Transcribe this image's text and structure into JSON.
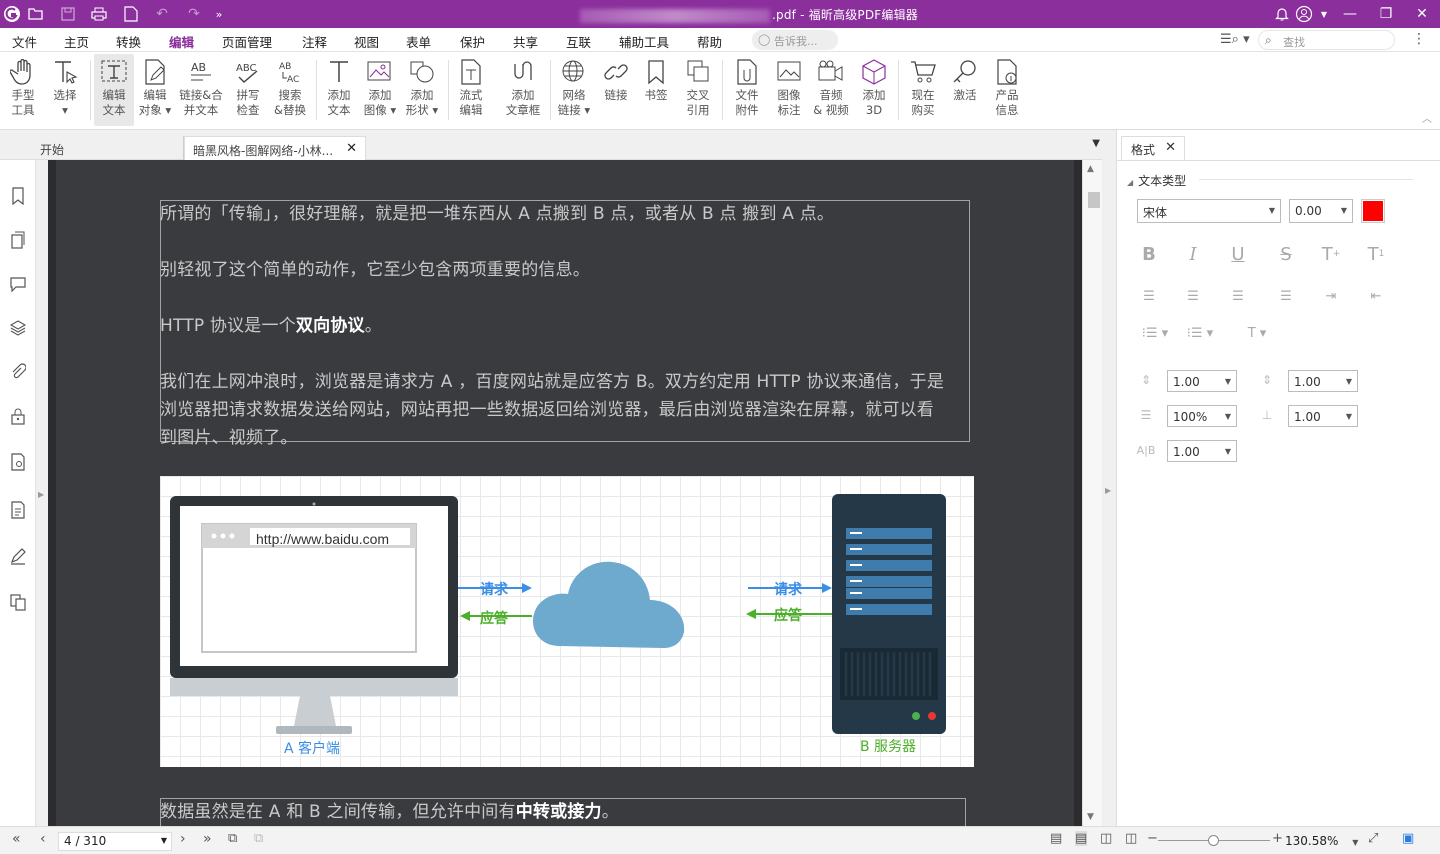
{
  "titlebar": {
    "title": ".pdf - 福昕高级PDF编辑器",
    "bg_color": "#8b2f9c"
  },
  "menu": {
    "items": [
      "文件",
      "主页",
      "转换",
      "编辑",
      "页面管理",
      "注释",
      "视图",
      "表单",
      "保护",
      "共享",
      "互联",
      "辅助工具",
      "帮助"
    ],
    "active": "编辑",
    "tellme_placeholder": "告诉我...",
    "search_placeholder": "查找"
  },
  "ribbon": {
    "buttons": [
      {
        "l1": "手型",
        "l2": "工具"
      },
      {
        "l1": "选择",
        "l2": "▾"
      },
      {
        "l1": "编辑",
        "l2": "文本"
      },
      {
        "l1": "编辑",
        "l2": "对象 ▾"
      },
      {
        "l1": "链接&合",
        "l2": "并文本"
      },
      {
        "l1": "拼写",
        "l2": "检查"
      },
      {
        "l1": "搜索",
        "l2": "&替换"
      },
      {
        "l1": "添加",
        "l2": "文本"
      },
      {
        "l1": "添加",
        "l2": "图像 ▾"
      },
      {
        "l1": "添加",
        "l2": "形状 ▾"
      },
      {
        "l1": "流式",
        "l2": "编辑"
      },
      {
        "l1": "添加",
        "l2": "文章框"
      },
      {
        "l1": "网络",
        "l2": "链接 ▾"
      },
      {
        "l1": "链接",
        "l2": ""
      },
      {
        "l1": "书签",
        "l2": ""
      },
      {
        "l1": "交叉",
        "l2": "引用"
      },
      {
        "l1": "文件",
        "l2": "附件"
      },
      {
        "l1": "图像",
        "l2": "标注"
      },
      {
        "l1": "音频",
        "l2": "& 视频"
      },
      {
        "l1": "添加",
        "l2": "3D"
      },
      {
        "l1": "现在",
        "l2": "购买"
      },
      {
        "l1": "激活",
        "l2": ""
      },
      {
        "l1": "产品",
        "l2": "信息"
      }
    ]
  },
  "tabs": {
    "start": "开始",
    "current": "暗黑风格-图解网络-小林..."
  },
  "document": {
    "block1": [
      [
        {
          "t": "所谓的「传输」，很好理解，就是把一堆东西从 A 点搬到 B 点，或者从 B 点 搬到 A 点。",
          "b": false
        }
      ],
      [
        {
          "t": "别轻视了这个简单的动作，它至少包含两项重要的信息。",
          "b": false
        }
      ],
      [
        {
          "t": "HTTP 协议是一个",
          "b": false
        },
        {
          "t": "双向协议",
          "b": true
        },
        {
          "t": "。",
          "b": false
        }
      ],
      [
        {
          "t": "我们在上网冲浪时，浏览器是请求方 A ，百度网站就是应答方 B。双方约定用 HTTP 协议来通信，于是",
          "b": false
        }
      ],
      [
        {
          "t": "浏览器把请求数据发送给网站，网站再把一些数据返回给浏览器，最后由浏览器渲染在屏幕，就可以看",
          "b": false
        }
      ],
      [
        {
          "t": "到图片、视频了。",
          "b": false
        }
      ]
    ],
    "figure": {
      "url": "http://www.baidu.com",
      "request": "请求",
      "response": "应答",
      "client": "A 客户端",
      "server": "B 服务器"
    },
    "block2": [
      [
        {
          "t": "数据虽然是在 A 和 B 之间传输，但允许中间有",
          "b": false
        },
        {
          "t": "中转或接力",
          "b": true
        },
        {
          "t": "。",
          "b": false
        }
      ]
    ]
  },
  "format_panel": {
    "tab": "格式",
    "section": "文本类型",
    "font": "宋体",
    "font_size": "0.00",
    "color": "#ff0000",
    "line_spacing": "1.00",
    "para_spacing": "1.00",
    "horiz_scale": "100%",
    "char_spacing": "1.00",
    "word_spacing": "1.00"
  },
  "status": {
    "page": "4 / 310",
    "zoom": "130.58%",
    "zoom_level": 0.5
  }
}
